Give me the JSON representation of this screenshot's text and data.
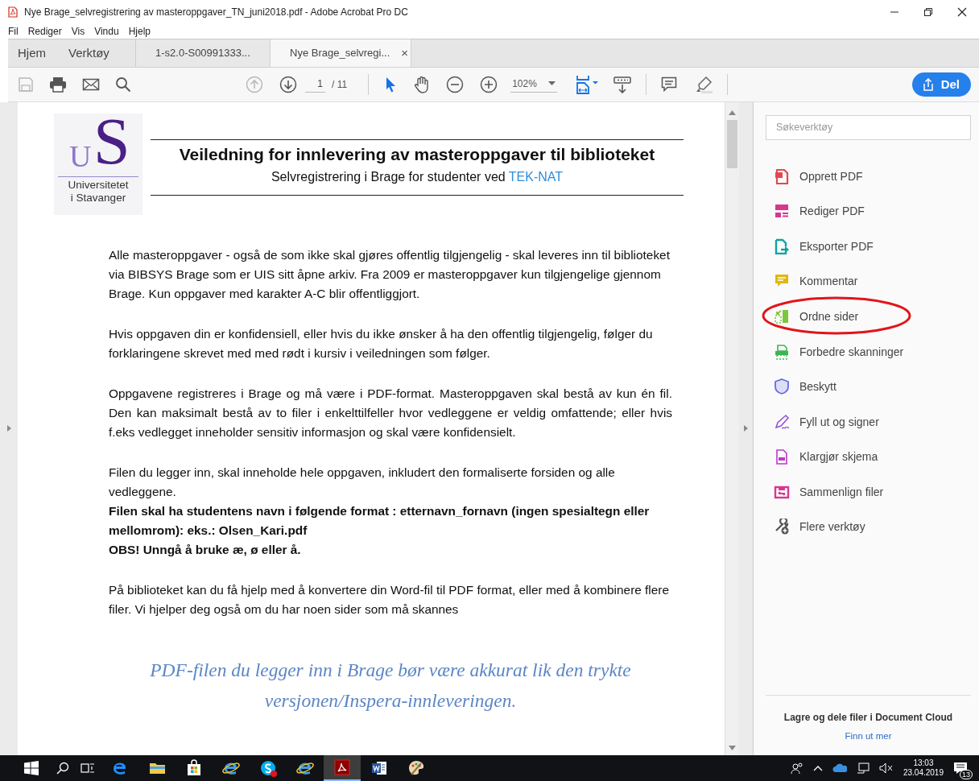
{
  "window": {
    "title": "Nye Brage_selvregistrering av masteroppgaver_TN_juni2018.pdf - Adobe Acrobat Pro DC"
  },
  "menu": [
    "Fil",
    "Rediger",
    "Vis",
    "Vindu",
    "Hjelp"
  ],
  "nav_tabs": [
    {
      "label": "Hjem",
      "selected": false
    },
    {
      "label": "Verktøy",
      "selected": false
    }
  ],
  "doc_tabs": [
    {
      "label": "1-s2.0-S00991333...",
      "selected": false
    },
    {
      "label": "Nye Brage_selvregi...",
      "selected": true,
      "close": "×"
    }
  ],
  "toolbar": {
    "save_disabled": true,
    "prev_disabled": true,
    "page": "1",
    "page_count": "/ 11",
    "zoom": "102%",
    "share": "Del"
  },
  "document": {
    "logo": {
      "mark_u": "U",
      "mark_s": "S",
      "name": [
        "Universitetet",
        "i Stavanger"
      ]
    },
    "title": "Veiledning for innlevering av masteroppgaver til biblioteket",
    "subtitle": "Selvregistrering i Brage for studenter ved",
    "subtitle_link": "TEK-NAT",
    "paragraphs": [
      {
        "kind": "body",
        "text": "Alle masteroppgaver - også de som ikke skal gjøres offentlig tilgjengelig - skal leveres inn til biblioteket via BIBSYS Brage som er UIS sitt åpne arkiv. Fra 2009 er masteroppgaver kun tilgjengelige gjennom Brage. Kun oppgaver med karakter A-C blir offentliggjort."
      },
      {
        "kind": "body",
        "text": "Hvis oppgaven din er konfidensiell, eller hvis du ikke ønsker å ha den offentlig tilgjengelig, følger du forklaringene skrevet med med rødt i kursiv i veiledningen som følger."
      },
      {
        "kind": "justified",
        "text": "Oppgavene registreres i Brage og må være i PDF-format. Masteroppgaven skal bestå av kun én fil. Den kan maksimalt bestå av to filer i enkelttilfeller hvor vedleggene er veldig omfattende; eller hvis f.eks vedlegget inneholder sensitiv informasjon og skal være konfidensielt."
      },
      {
        "kind": "body",
        "text": "Filen du legger inn, skal inneholde hele oppgaven, inkludert den formaliserte forsiden og alle vedleggene."
      },
      {
        "kind": "bold",
        "text": "Filen skal ha studentens navn i følgende format : etternavn_fornavn (ingen spesialtegn eller mellomrom): eks.: Olsen_Kari.pdf"
      },
      {
        "kind": "bold",
        "text": "OBS! Unngå å bruke æ, ø eller å."
      },
      {
        "kind": "body",
        "text": "På biblioteket kan du få hjelp med å konvertere din Word-fil til PDF format, eller med å kombinere flere filer. Vi hjelper deg også om du har noen sider som må skannes"
      },
      {
        "kind": "quote",
        "text": "PDF-filen du legger inn i Brage bør være akkurat lik den trykte versjonen/Inspera-innleveringen."
      }
    ]
  },
  "tools": {
    "search_placeholder": "Søkeverktøy",
    "items": [
      {
        "label": "Opprett PDF",
        "color": "#e34850",
        "highlighted": false
      },
      {
        "label": "Rediger PDF",
        "color": "#d83790",
        "highlighted": false
      },
      {
        "label": "Eksporter PDF",
        "color": "#12a2a2",
        "highlighted": false
      },
      {
        "label": "Kommentar",
        "color": "#e0b712",
        "highlighted": false
      },
      {
        "label": "Ordne sider",
        "color": "#7ec73d",
        "highlighted": true
      },
      {
        "label": "Forbedre skanninger",
        "color": "#3db555",
        "highlighted": false
      },
      {
        "label": "Beskytt",
        "color": "#6767ec",
        "highlighted": false
      },
      {
        "label": "Fyll ut og signer",
        "color": "#9256d9",
        "highlighted": false
      },
      {
        "label": "Klargjør skjema",
        "color": "#c038cc",
        "highlighted": false
      },
      {
        "label": "Sammenlign filer",
        "color": "#d83790",
        "highlighted": false
      },
      {
        "label": "Flere verktøy",
        "color": "#555555",
        "highlighted": false
      }
    ],
    "cloud_title": "Lagre og dele filer i Document Cloud",
    "cloud_link": "Finn ut mer"
  },
  "taskbar": {
    "apps": [
      {
        "selected": false
      },
      {
        "selected": false
      },
      {
        "selected": false
      },
      {
        "selected": false
      },
      {
        "selected": false
      },
      {
        "selected": false
      },
      {
        "selected": true
      },
      {
        "selected": false
      },
      {
        "selected": false
      }
    ],
    "time": "13:03",
    "date": "23.04.2019",
    "notifications": "13"
  }
}
